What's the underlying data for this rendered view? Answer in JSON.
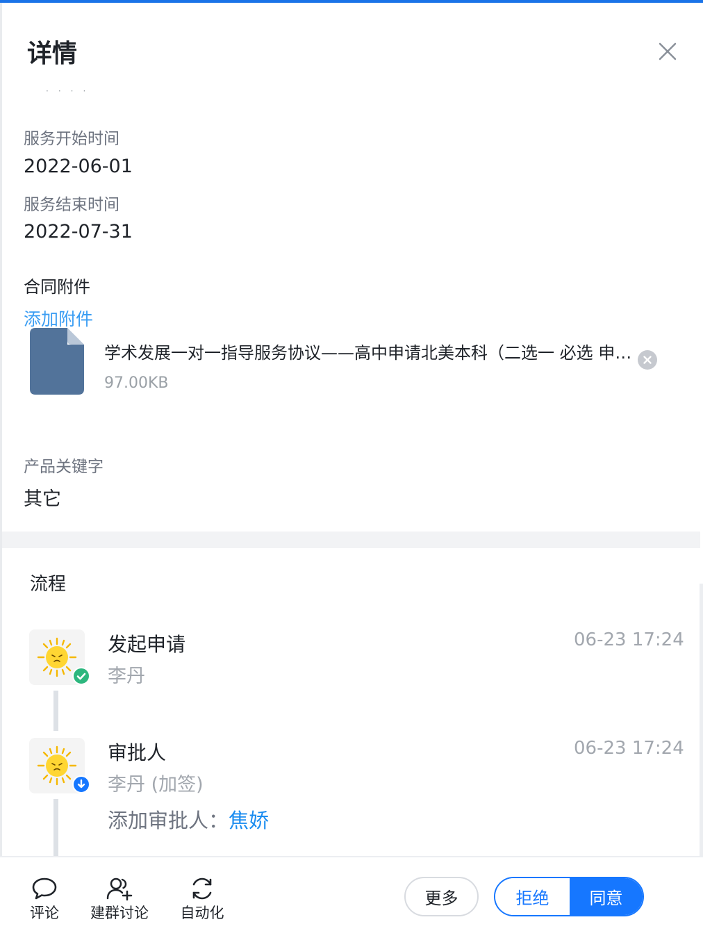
{
  "header": {
    "title": "详情"
  },
  "fields": {
    "service_start": {
      "label": "服务开始时间",
      "value": "2022-06-01"
    },
    "service_end": {
      "label": "服务结束时间",
      "value": "2022-07-31"
    },
    "contract": {
      "label": "合同附件",
      "add_link": "添加附件",
      "file": {
        "name": "学术发展一对一指导服务协议——高中申请北美本科（二选一 必选 申请英国本科+辅导托福/雅思）",
        "size": "97.00KB",
        "icon": "file-icon"
      }
    },
    "keyword": {
      "label": "产品关键字",
      "value": "其它"
    }
  },
  "flow": {
    "title": "流程",
    "steps": [
      {
        "name": "发起申请",
        "person": "李丹",
        "time": "06-23 17:24",
        "status_icon": "check-icon"
      },
      {
        "name": "审批人",
        "person": "李丹 (加签)",
        "time": "06-23 17:24",
        "status_icon": "arrow-down-icon",
        "add_label": "添加审批人：",
        "add_name": "焦娇"
      }
    ]
  },
  "toolbar": {
    "comment": "评论",
    "group": "建群讨论",
    "automation": "自动化",
    "more": "更多",
    "reject": "拒绝",
    "agree": "同意"
  },
  "colors": {
    "accent": "#1677ff",
    "link": "#3a9df3",
    "success": "#2db77e"
  }
}
